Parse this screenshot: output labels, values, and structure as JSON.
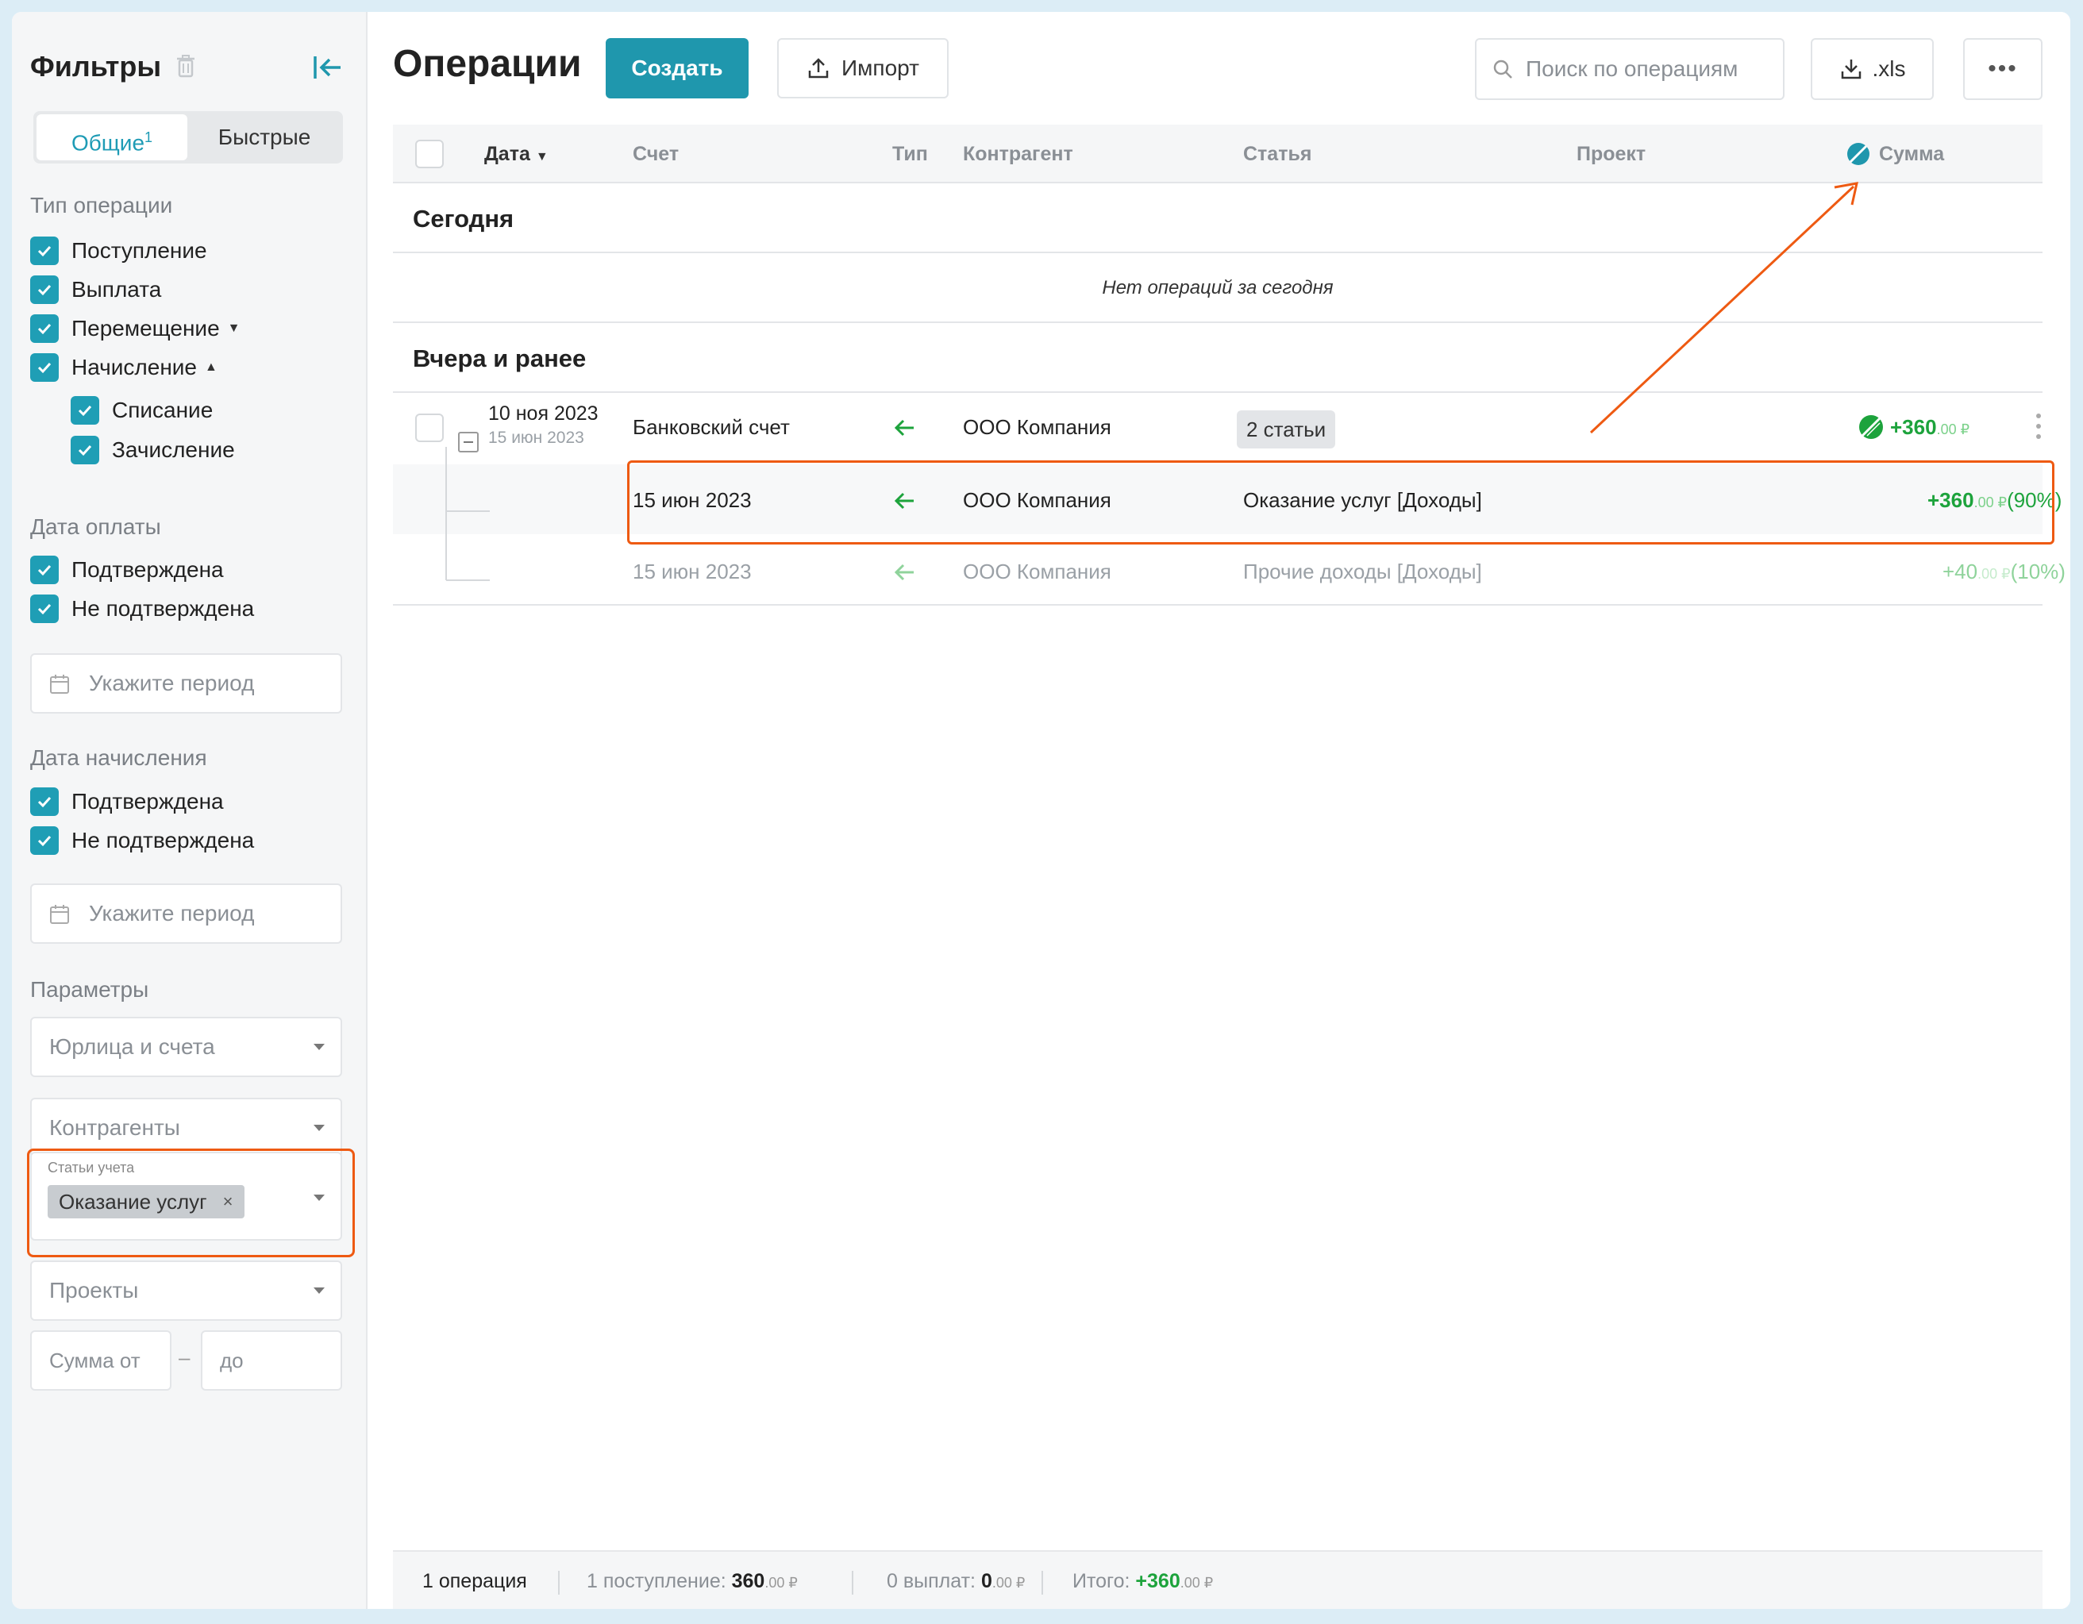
{
  "sidebar": {
    "title": "Фильтры",
    "tabs": [
      {
        "label": "Общие",
        "badge": "1"
      },
      {
        "label": "Быстрые"
      }
    ],
    "operation_type": {
      "label": "Тип операции",
      "items": [
        "Поступление",
        "Выплата",
        "Перемещение",
        "Начисление"
      ],
      "sub_items": [
        "Списание",
        "Зачисление"
      ]
    },
    "payment_date": {
      "label": "Дата оплаты",
      "items": [
        "Подтверждена",
        "Не подтверждена"
      ],
      "period_placeholder": "Укажите период"
    },
    "accrual_date": {
      "label": "Дата начисления",
      "items": [
        "Подтверждена",
        "Не подтверждена"
      ],
      "period_placeholder": "Укажите период"
    },
    "params": {
      "label": "Параметры",
      "entities": "Юрлица и счета",
      "counterparties": "Контрагенты",
      "articles_label": "Статьи учета",
      "articles_tag": "Оказание услуг",
      "projects": "Проекты",
      "sum_from": "Сумма от",
      "sum_to": "до"
    }
  },
  "main": {
    "title": "Операции",
    "create_label": "Создать",
    "import_label": "Импорт",
    "search_placeholder": "Поиск по операциям",
    "xls_label": ".xls",
    "more_label": "•••",
    "columns": {
      "date": "Дата",
      "account": "Счет",
      "type": "Тип",
      "counterparty": "Контрагент",
      "article": "Статья",
      "project": "Проект",
      "sum": "Сумма"
    },
    "group_today": "Сегодня",
    "empty_today": "Нет операций за сегодня",
    "group_earlier": "Вчера и ранее",
    "operation": {
      "date": "10 ноя 2023",
      "subdate": "15 июн 2023",
      "account": "Банковский счет",
      "counterparty": "ООО Компания",
      "article_tag": "2 статьи",
      "amount": "+360",
      "cents": ".00 ₽"
    },
    "splits": [
      {
        "date": "15 июн 2023",
        "counterparty": "ООО Компания",
        "article": "Оказание услуг [Доходы]",
        "amount": "+360",
        "cents": ".00 ₽",
        "pct": "(90%)"
      },
      {
        "date": "15 июн 2023",
        "counterparty": "ООО Компания",
        "article": "Прочие доходы [Доходы]",
        "amount": "+40",
        "cents": ".00 ₽",
        "pct": "(10%)"
      }
    ]
  },
  "footer": {
    "count": "1 операция",
    "income_label": "1 поступление:",
    "income_value": "360",
    "income_cents": ".00 ₽",
    "payout_label": "0 выплат:",
    "payout_value": "0",
    "payout_cents": ".00 ₽",
    "total_label": "Итого:",
    "total_value": "+360",
    "total_cents": ".00 ₽"
  },
  "colors": {
    "accent": "#1f97ad",
    "income_green": "#1da33c",
    "highlight": "#ee5a12"
  }
}
